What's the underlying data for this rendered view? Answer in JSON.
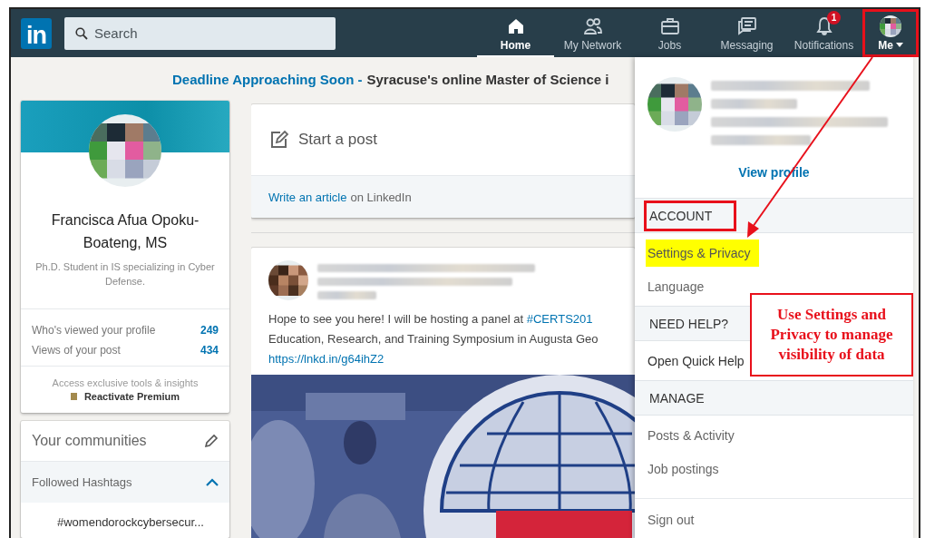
{
  "nav": {
    "logo": "in",
    "search": {
      "placeholder": "Search"
    },
    "items": [
      {
        "label": "Home",
        "kind": "home",
        "selected": true,
        "marked": false
      },
      {
        "label": "My Network",
        "kind": "people",
        "selected": false,
        "marked": false
      },
      {
        "label": "Jobs",
        "kind": "briefcase",
        "selected": false,
        "marked": false
      },
      {
        "label": "Messaging",
        "kind": "chat",
        "selected": false,
        "marked": false
      },
      {
        "label": "Notifications",
        "kind": "bell",
        "selected": false,
        "marked": false,
        "badge": "1"
      },
      {
        "label": "Me",
        "kind": "avatar",
        "selected": false,
        "marked": true
      }
    ]
  },
  "banner": {
    "title": "Deadline Approaching Soon -",
    "text": "Syracuse's online Master of Science i"
  },
  "profile": {
    "name": "Francisca Afua Opoku-Boateng, MS",
    "headline": "Ph.D. Student in IS specializing in Cyber Defense.",
    "stats": [
      {
        "label": "Who's viewed your profile",
        "value": "249"
      },
      {
        "label": "Views of your post",
        "value": "434"
      }
    ],
    "premium": {
      "text": "Access exclusive tools & insights",
      "link": "Reactivate Premium"
    }
  },
  "communities": {
    "title": "Your communities",
    "sections": [
      {
        "label": "Followed Hashtags",
        "expanded": true
      }
    ],
    "hashtags": [
      "#womendorockcybersecur..."
    ]
  },
  "share": {
    "prompt": "Start a post",
    "article_link": "Write an article",
    "article_suffix": "on LinkedIn"
  },
  "post": {
    "text_before": "Hope to see you here! I will be hosting a panel at ",
    "hashtag": "#CERTS201",
    "text_after": "Education, Research, and Training Symposium in Augusta Geo",
    "link": "https://lnkd.in/g64ihZ2"
  },
  "dropdown": {
    "view_profile": "View profile",
    "sections": [
      {
        "title": "ACCOUNT",
        "marked": true,
        "items": [
          {
            "label": "Settings & Privacy",
            "highlighted": true
          },
          {
            "label": "Language",
            "highlighted": false
          }
        ]
      },
      {
        "title": "NEED HELP?",
        "marked": false,
        "items": [
          {
            "label": "Open Quick Help",
            "highlighted": false
          }
        ]
      },
      {
        "title": "MANAGE",
        "marked": false,
        "items": [
          {
            "label": "Posts & Activity",
            "highlighted": false
          },
          {
            "label": "Job postings",
            "highlighted": false
          }
        ]
      }
    ],
    "sign_out": "Sign out"
  },
  "callout": {
    "text": "Use Settings and Privacy to manage visibility of data"
  }
}
